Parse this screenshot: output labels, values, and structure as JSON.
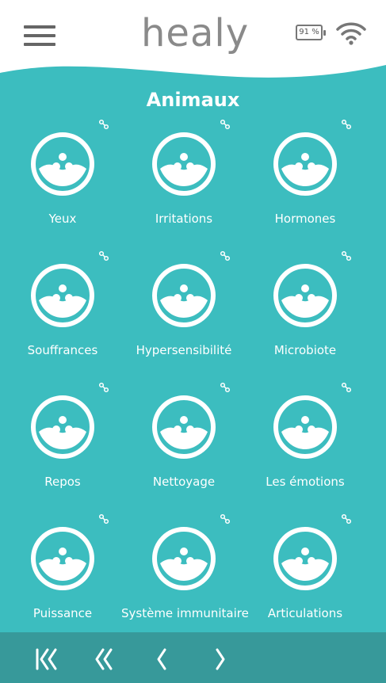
{
  "header": {
    "logo_text": "healy",
    "battery_label": "91 %",
    "page_title": "Animaux"
  },
  "tiles": [
    {
      "label": "Yeux"
    },
    {
      "label": "Irritations"
    },
    {
      "label": "Hormones"
    },
    {
      "label": "Souffrances"
    },
    {
      "label": "Hypersensibilité"
    },
    {
      "label": "Microbiote"
    },
    {
      "label": "Repos"
    },
    {
      "label": "Nettoyage"
    },
    {
      "label": "Les émotions"
    },
    {
      "label": "Puissance"
    },
    {
      "label": "Système immunitaire"
    },
    {
      "label": "Articulations"
    }
  ],
  "colors": {
    "background": "#3cbdbf",
    "bottom_bar": "#37999a",
    "header": "#ffffff"
  },
  "icons": {
    "tile_icon": "healy-program-icon",
    "tile_badge": "link-icon",
    "nav": [
      "first-page-icon",
      "double-chevron-left-icon",
      "chevron-left-icon",
      "chevron-right-icon"
    ]
  }
}
